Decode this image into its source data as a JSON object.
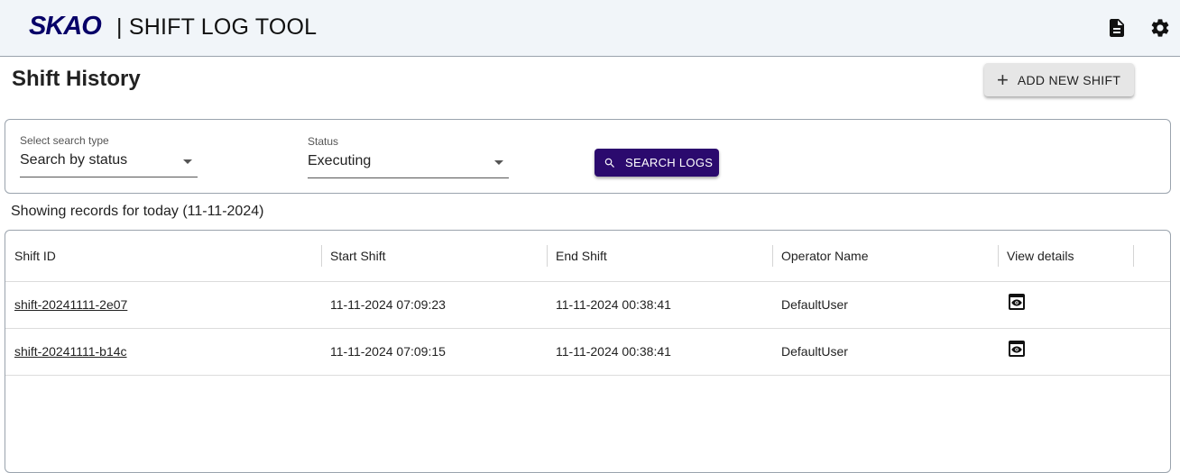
{
  "header": {
    "logo_text": "SKAO",
    "app_title": "| SHIFT LOG TOOL",
    "icons": [
      "document-icon",
      "gear-icon"
    ]
  },
  "page": {
    "title": "Shift History",
    "add_button_label": "ADD NEW SHIFT"
  },
  "search": {
    "type_label": "Select search type",
    "type_value": "Search by status",
    "status_label": "Status",
    "status_value": "Executing",
    "button_label": "SEARCH LOGS"
  },
  "records_caption": "Showing records for today (11-11-2024)",
  "table": {
    "columns": [
      "Shift ID",
      "Start Shift",
      "End Shift",
      "Operator Name",
      "View details"
    ],
    "rows": [
      {
        "shift_id": "shift-20241111-2e07",
        "start": "11-11-2024 07:09:23",
        "end": "11-11-2024 00:38:41",
        "operator": "DefaultUser"
      },
      {
        "shift_id": "shift-20241111-b14c",
        "start": "11-11-2024 07:09:15",
        "end": "11-11-2024 00:38:41",
        "operator": "DefaultUser"
      }
    ]
  },
  "colors": {
    "brand_dark": "#070068",
    "brand_accent": "#e50869",
    "primary_button": "#2b0a6e",
    "appbar_bg": "#f1f5f9"
  }
}
